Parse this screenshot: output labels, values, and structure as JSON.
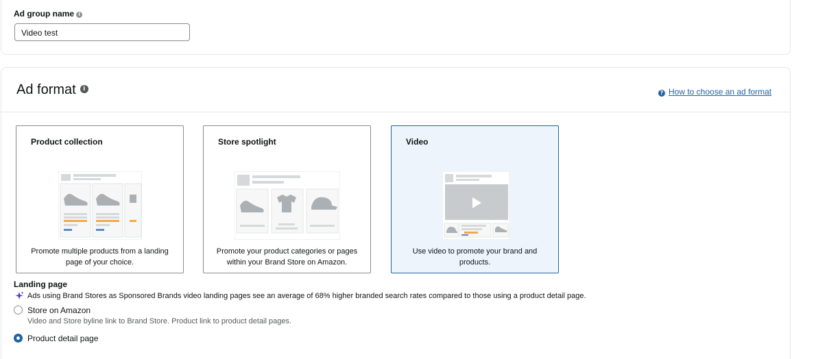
{
  "adgroup": {
    "label": "Ad group name",
    "value": "Video test"
  },
  "adformat": {
    "title": "Ad format",
    "help_link": "How to choose an ad format",
    "tiles": [
      {
        "title": "Product collection",
        "desc": "Promote multiple products from a landing page of your choice."
      },
      {
        "title": "Store spotlight",
        "desc": "Promote your product categories or pages within your Brand Store on Amazon."
      },
      {
        "title": "Video",
        "desc": "Use video to promote your brand and products."
      }
    ],
    "selected_tile": "Video"
  },
  "landing": {
    "title": "Landing page",
    "tip": "Ads using Brand Stores as Sponsored Brands video landing pages see an average of 68% higher branded search rates compared to those using a product detail page.",
    "options": [
      {
        "label": "Store on Amazon",
        "desc": "Video and Store byline link to Brand Store. Product link to product detail pages.",
        "selected": false
      },
      {
        "label": "Product detail page",
        "desc": "",
        "selected": true
      }
    ]
  },
  "colors": {
    "accent": "#2162a1",
    "selected_tile_bg": "#edf4fc",
    "star": "#f3a847"
  }
}
